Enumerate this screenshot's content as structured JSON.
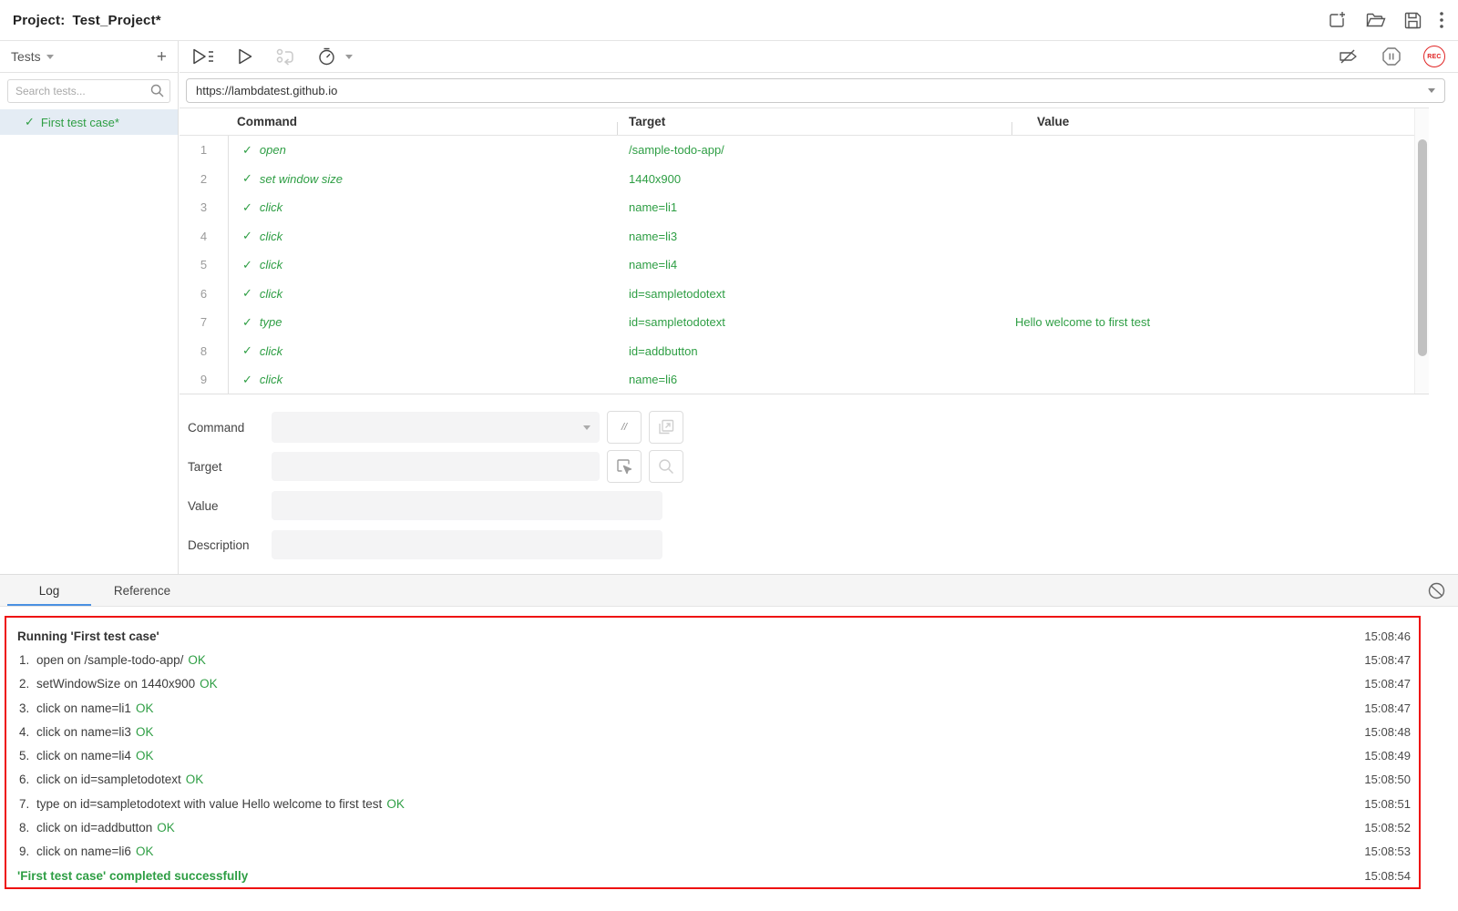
{
  "colors": {
    "green": "#2e9e44",
    "rec_red": "#e02424",
    "log_border_red": "#ee1111",
    "tab_underline_blue": "#4a90e2",
    "selected_test_bg": "#e4ecf4"
  },
  "header": {
    "project_label": "Project:",
    "project_name": "Test_Project*"
  },
  "icons": {
    "check": "✓"
  },
  "sidebar": {
    "title": "Tests",
    "add_label": "+",
    "search_placeholder": "Search tests...",
    "tests": [
      {
        "name": "First test case*",
        "status": "passed",
        "selected": true
      }
    ]
  },
  "toolbar": {
    "url": "https://lambdatest.github.io",
    "rec_label": "REC"
  },
  "table": {
    "headers": {
      "command": "Command",
      "target": "Target",
      "value": "Value"
    },
    "rows": [
      {
        "n": "1",
        "command": "open",
        "target": "/sample-todo-app/",
        "value": ""
      },
      {
        "n": "2",
        "command": "set window size",
        "target": "1440x900",
        "value": ""
      },
      {
        "n": "3",
        "command": "click",
        "target": "name=li1",
        "value": ""
      },
      {
        "n": "4",
        "command": "click",
        "target": "name=li3",
        "value": ""
      },
      {
        "n": "5",
        "command": "click",
        "target": "name=li4",
        "value": ""
      },
      {
        "n": "6",
        "command": "click",
        "target": "id=sampletodotext",
        "value": ""
      },
      {
        "n": "7",
        "command": "type",
        "target": "id=sampletodotext",
        "value": "Hello welcome to first test"
      },
      {
        "n": "8",
        "command": "click",
        "target": "id=addbutton",
        "value": ""
      },
      {
        "n": "9",
        "command": "click",
        "target": "name=li6",
        "value": ""
      }
    ]
  },
  "form": {
    "command_label": "Command",
    "target_label": "Target",
    "value_label": "Value",
    "description_label": "Description",
    "comment_button_label": "//",
    "command_value": "",
    "target_value": "",
    "value_value": "",
    "description_value": ""
  },
  "tabs": {
    "log": "Log",
    "reference": "Reference"
  },
  "log": {
    "entries": [
      {
        "text": "Running 'First test case'",
        "time": "15:08:46"
      },
      {
        "num": "1.",
        "text": "open on /sample-todo-app/",
        "ok": "OK",
        "time": "15:08:47"
      },
      {
        "num": "2.",
        "text": "setWindowSize on 1440x900",
        "ok": "OK",
        "time": "15:08:47"
      },
      {
        "num": "3.",
        "text": "click on name=li1",
        "ok": "OK",
        "time": "15:08:47"
      },
      {
        "num": "4.",
        "text": "click on name=li3",
        "ok": "OK",
        "time": "15:08:48"
      },
      {
        "num": "5.",
        "text": "click on name=li4",
        "ok": "OK",
        "time": "15:08:49"
      },
      {
        "num": "6.",
        "text": "click on id=sampletodotext",
        "ok": "OK",
        "time": "15:08:50"
      },
      {
        "num": "7.",
        "text": "type on id=sampletodotext with value Hello welcome to first test",
        "ok": "OK",
        "time": "15:08:51"
      },
      {
        "num": "8.",
        "text": "click on id=addbutton",
        "ok": "OK",
        "time": "15:08:52"
      },
      {
        "num": "9.",
        "text": "click on name=li6",
        "ok": "OK",
        "time": "15:08:53"
      },
      {
        "text": "'First test case' completed successfully",
        "time": "15:08:54"
      }
    ]
  }
}
